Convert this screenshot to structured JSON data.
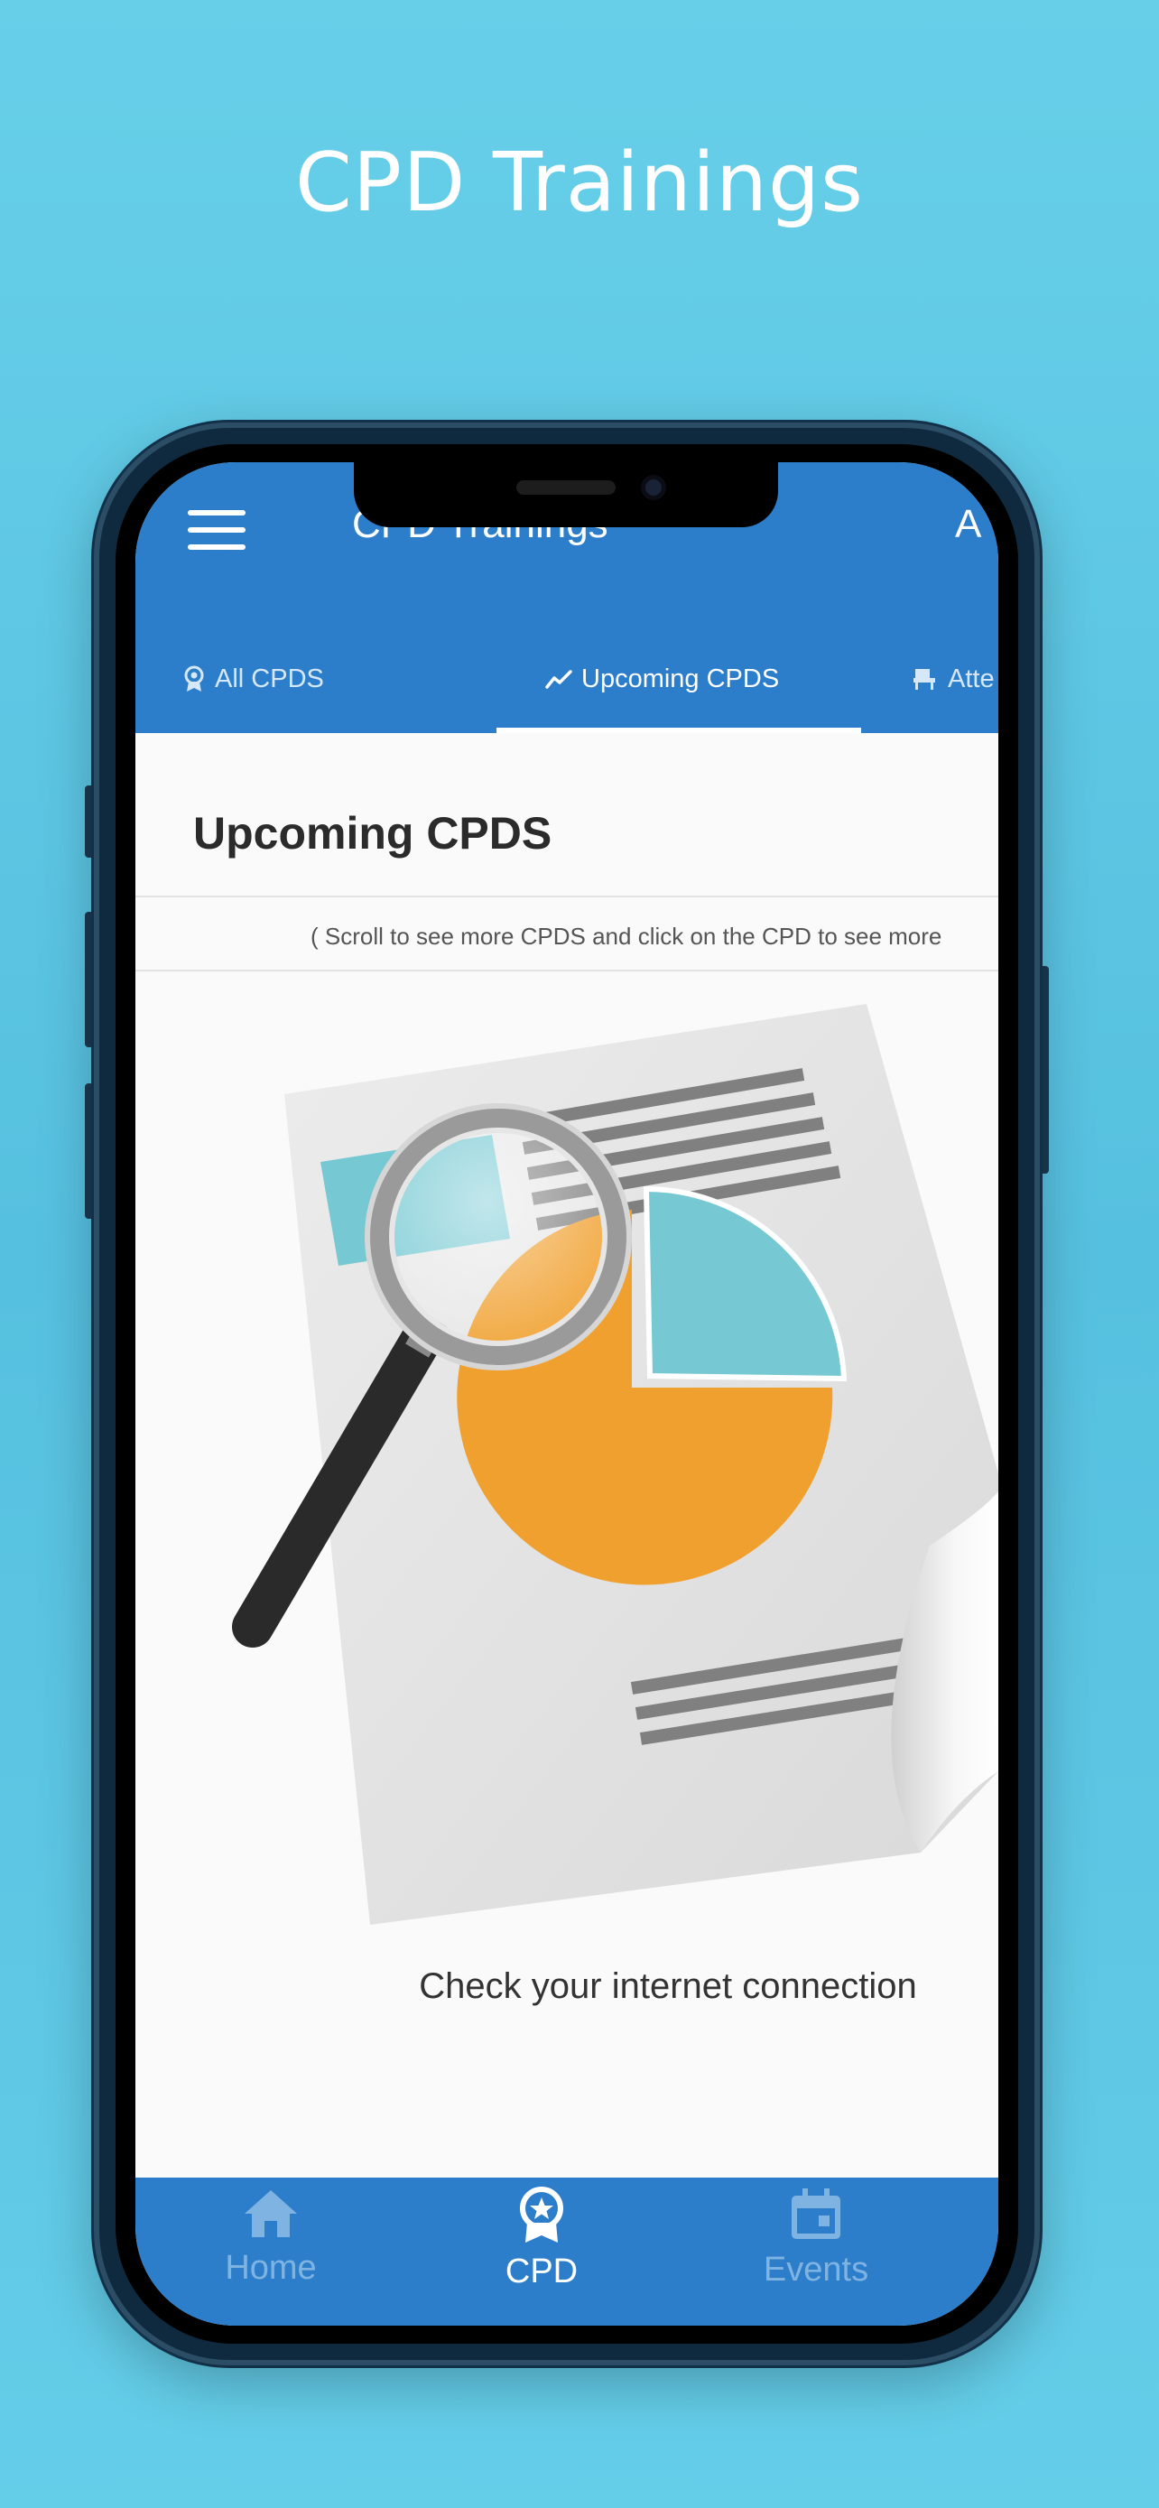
{
  "promo": {
    "title": "CPD Trainings"
  },
  "app_bar": {
    "title": "CPD Trainings",
    "right_text": "A"
  },
  "tabs": [
    {
      "label": "All CPDS",
      "icon": "badge-icon",
      "active": false
    },
    {
      "label": "Upcoming CPDS",
      "icon": "trend-icon",
      "active": true
    },
    {
      "label": "Atte",
      "icon": "chair-icon",
      "active": false
    }
  ],
  "content": {
    "heading": "Upcoming CPDS",
    "hint": "( Scroll to see more CPDS and click on the CPD to see more",
    "error": "Check your internet connection"
  },
  "bottom_nav": [
    {
      "label": "Home",
      "icon": "home-icon",
      "active": false
    },
    {
      "label": "CPD",
      "icon": "award-icon",
      "active": true
    },
    {
      "label": "Events",
      "icon": "calendar-icon",
      "active": false
    }
  ],
  "colors": {
    "background": "#5cc6e4",
    "primary": "#2c7ecb",
    "nav_inactive": "#7fb4e2",
    "pie_orange": "#f0a02e",
    "pie_teal": "#76c9d3"
  }
}
